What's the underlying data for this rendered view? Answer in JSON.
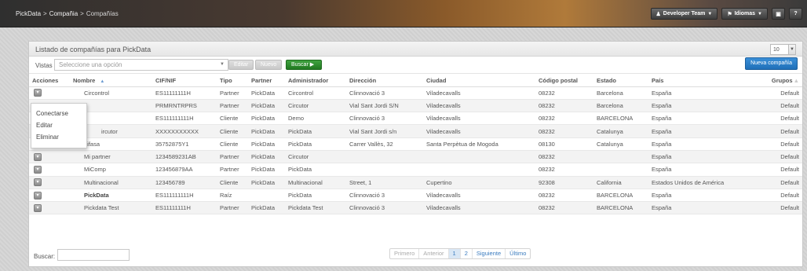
{
  "topbar": {
    "breadcrumb": [
      "PickData",
      "Compañia",
      "Compañías"
    ],
    "sep": ">",
    "developer_team": "Developer Team",
    "idiomas": "Idiomas"
  },
  "panel": {
    "title": "Listado de compañías para PickData",
    "page_size": "10",
    "vistas_label": "Vistas",
    "vistas_placeholder": "Seleccione una opción",
    "btn_editar": "Editar",
    "btn_nuevo": "Nuevo",
    "btn_buscar": "Buscar",
    "btn_nueva_compania": "Nueva compañía"
  },
  "table": {
    "headers": [
      "Acciones",
      "Nombre",
      "CIF/NIF",
      "Tipo",
      "Partner",
      "Administrador",
      "Dirección",
      "Ciudad",
      "Código postal",
      "Estado",
      "País",
      "Grupos"
    ],
    "rows": [
      [
        "Circontrol",
        "ES11111111H",
        "Partner",
        "PickData",
        "Circontrol",
        "Clinnovació 3",
        "Viladecavalls",
        "08232",
        "Barcelona",
        "España",
        "Default"
      ],
      [
        "",
        "PRMRNTRPRS",
        "Partner",
        "PickData",
        "Circutor",
        "Vial Sant Jordi S/N",
        "Viladecavalls",
        "08232",
        "Barcelona",
        "España",
        "Default"
      ],
      [
        "",
        "ES111111111H",
        "Cliente",
        "PickData",
        "Demo",
        "Clinnovació 3",
        "Viladecavalls",
        "08232",
        "BARCELONA",
        "España",
        "Default"
      ],
      [
        "ircutor",
        "XXXXXXXXXXX",
        "Cliente",
        "PickData",
        "PickData",
        "Vial Sant Jordi s/n",
        "Viladecavalls",
        "08232",
        "Catalunya",
        "España",
        "Default"
      ],
      [
        "Lifasa",
        "35752875Y1",
        "Cliente",
        "PickData",
        "PickData",
        "Carrer Vallès, 32",
        "Santa Perpètua de Mogoda",
        "08130",
        "Catalunya",
        "España",
        "Default"
      ],
      [
        "Mi partner",
        "1234589231AB",
        "Partner",
        "PickData",
        "Circutor",
        "",
        "",
        "08232",
        "",
        "España",
        "Default"
      ],
      [
        "MiComp",
        "123456879AA",
        "Partner",
        "PickData",
        "PickData",
        "",
        "",
        "08232",
        "",
        "España",
        "Default"
      ],
      [
        "Multinacional",
        "123456789",
        "Cliente",
        "PickData",
        "Multinacional",
        "Street, 1",
        "Cupertino",
        "92308",
        "California",
        "Estados Unidos de América",
        "Default"
      ],
      [
        "PickData",
        "ES111111111H",
        "Raíz",
        "",
        "PickData",
        "Clinnovació 3",
        "Viladecavalls",
        "08232",
        "BARCELONA",
        "España",
        "Default"
      ],
      [
        "Pickdata Test",
        "ES11111111H",
        "Partner",
        "PickData",
        "Pickdata Test",
        "Clinnovació 3",
        "Viladecavalls",
        "08232",
        "BARCELONA",
        "España",
        "Default"
      ]
    ]
  },
  "context_menu": [
    "Conectarse",
    "Editar",
    "Eliminar"
  ],
  "footer": {
    "buscar_label": "Buscar:",
    "pager": [
      "Primero",
      "Anterior",
      "1",
      "2",
      "Siguiente",
      "Último"
    ]
  },
  "colors": {
    "accent_green": "#2d8f2d",
    "accent_blue": "#2a7fc9"
  }
}
